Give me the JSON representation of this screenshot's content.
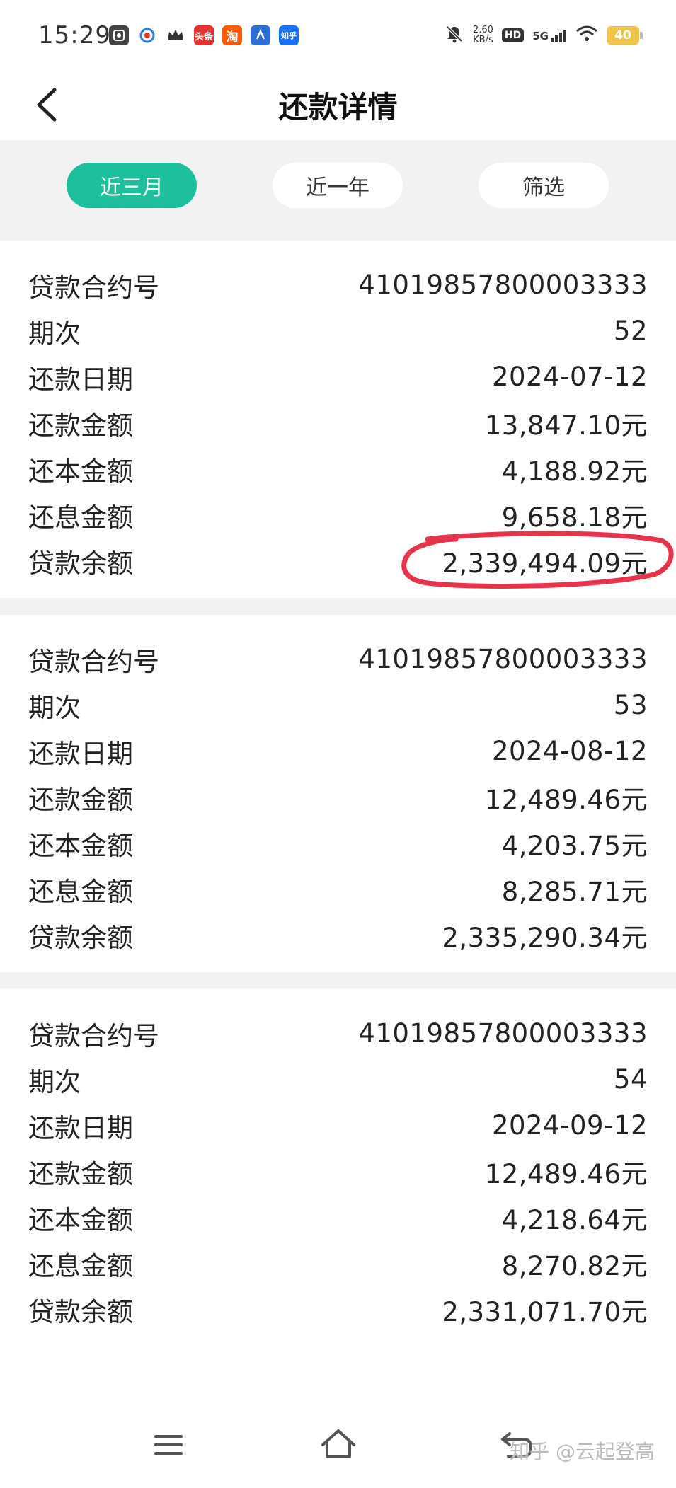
{
  "status_bar": {
    "time": "15:29",
    "apps": [
      {
        "icon": "app-a-icon",
        "text": "",
        "color": "#444444"
      },
      {
        "icon": "app-b-icon",
        "text": "",
        "color": "#2f7de1"
      },
      {
        "icon": "crown-app-icon",
        "text": "",
        "color": "#333333"
      },
      {
        "icon": "toutiao-icon",
        "text": "头条",
        "color": "#e8322d"
      },
      {
        "icon": "taobao-icon",
        "text": "淘",
        "color": "#ff5a00"
      },
      {
        "icon": "app-c-icon",
        "text": "",
        "color": "#2b6fd6"
      },
      {
        "icon": "zhihu-icon",
        "text": "知乎",
        "color": "#1772f6"
      }
    ],
    "net_speed_value": "2.60",
    "net_speed_unit": "KB/s",
    "hd": "HD",
    "network": "5G",
    "battery": "40"
  },
  "header": {
    "title": "还款详情"
  },
  "filters": [
    {
      "label": "近三月",
      "active": true
    },
    {
      "label": "近一年",
      "active": false
    },
    {
      "label": "筛选",
      "active": false
    }
  ],
  "labels": {
    "contract": "贷款合约号",
    "period": "期次",
    "date": "还款日期",
    "amount": "还款金额",
    "principal": "还本金额",
    "interest": "还息金额",
    "balance": "贷款余额"
  },
  "records": [
    {
      "contract": "41019857800003333",
      "period": "52",
      "date": "2024-07-12",
      "amount": "13,847.10元",
      "principal": "4,188.92元",
      "interest": "9,658.18元",
      "balance": "2,339,494.09元"
    },
    {
      "contract": "41019857800003333",
      "period": "53",
      "date": "2024-08-12",
      "amount": "12,489.46元",
      "principal": "4,203.75元",
      "interest": "8,285.71元",
      "balance": "2,335,290.34元"
    },
    {
      "contract": "41019857800003333",
      "period": "54",
      "date": "2024-09-12",
      "amount": "12,489.46元",
      "principal": "4,218.64元",
      "interest": "8,270.82元",
      "balance": "2,331,071.70元"
    }
  ],
  "annotation_color": "#e8344a",
  "accent_color": "#1dbf9c",
  "watermark": "知乎 @云起登高"
}
